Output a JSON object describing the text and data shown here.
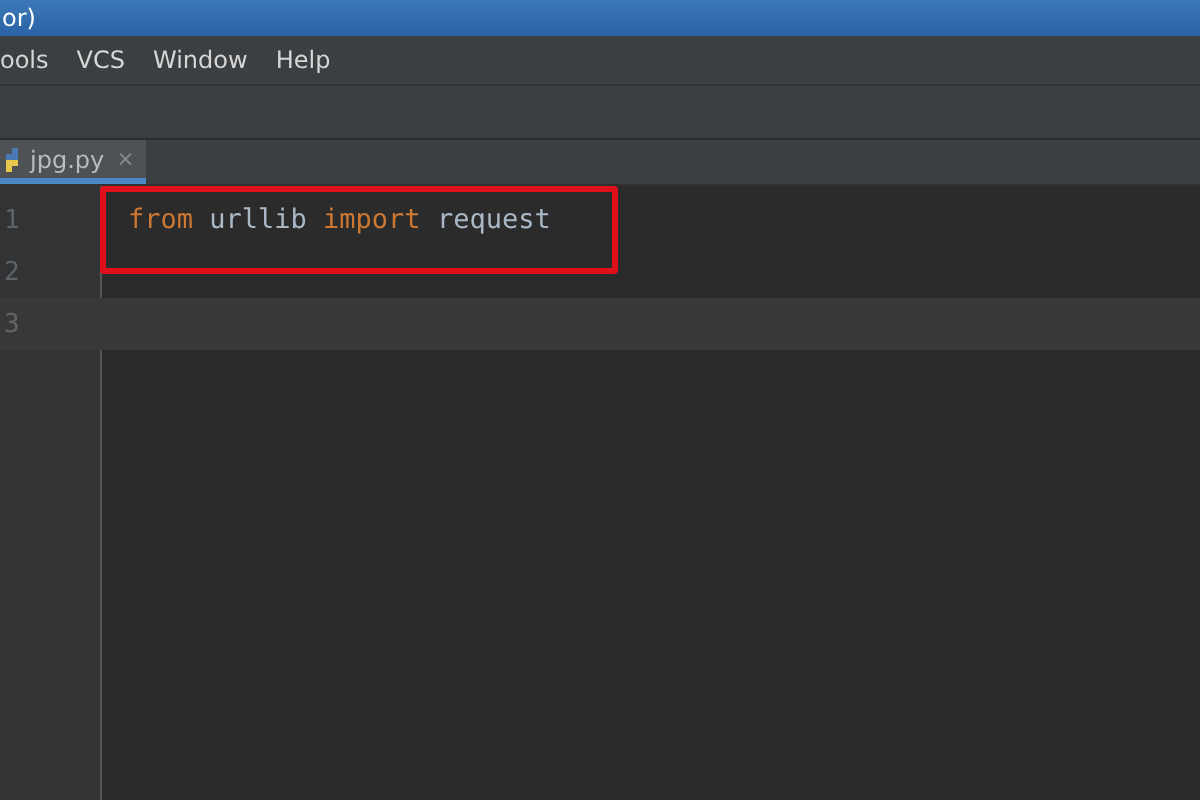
{
  "window": {
    "title": "or)"
  },
  "menu": [
    "ools",
    "VCS",
    "Window",
    "Help"
  ],
  "tabs": [
    {
      "label": "jpg.py",
      "close": "×",
      "selected": true
    }
  ],
  "editor": {
    "lines": [
      {
        "number": "1",
        "current": false,
        "tokens": [
          {
            "text": "from",
            "kind": "keyword"
          },
          {
            "text": " urllib ",
            "kind": "name"
          },
          {
            "text": "import",
            "kind": "keyword"
          },
          {
            "text": " request",
            "kind": "name"
          }
        ]
      },
      {
        "number": "2",
        "current": false
      },
      {
        "number": "3",
        "current": true
      }
    ]
  }
}
